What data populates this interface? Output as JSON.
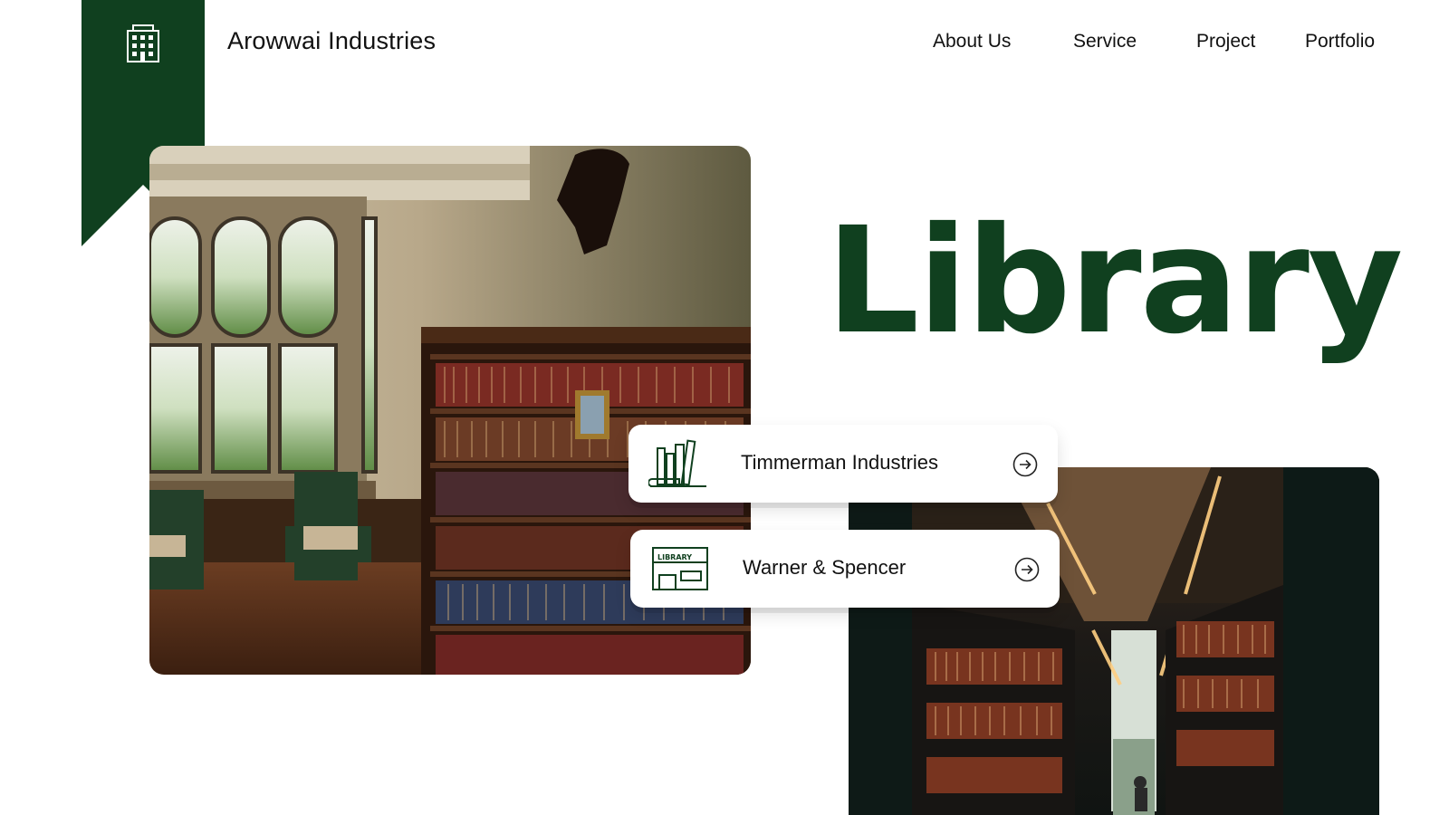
{
  "header": {
    "brand": "Arowwai Industries",
    "nav": [
      "About Us",
      "Service",
      "Project",
      "Portfolio"
    ]
  },
  "hero": {
    "title": "Library"
  },
  "cards": [
    {
      "label": "Timmerman Industries",
      "icon": "books-icon"
    },
    {
      "label": "Warner & Spencer",
      "icon": "library-building-icon",
      "icon_text": "LIBRARY"
    }
  ],
  "colors": {
    "accent": "#10401f",
    "background": "#ffffff",
    "text": "#111111"
  }
}
